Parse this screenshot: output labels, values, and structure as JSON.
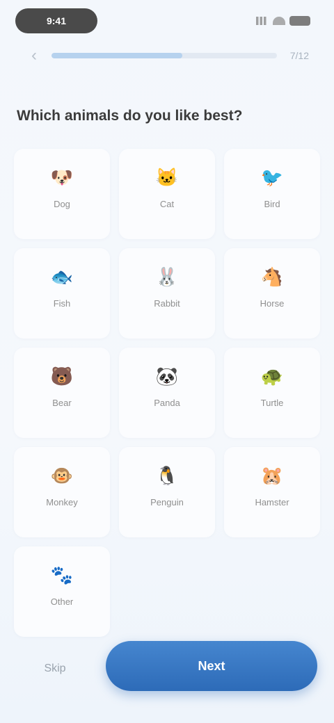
{
  "status_bar": {
    "time": "9:41"
  },
  "header": {
    "progress": 0.58,
    "step_count": "7/12"
  },
  "question": "Which animals do you like best?",
  "options": [
    {
      "label": "Dog",
      "icon": "dog-icon",
      "glyph": "🐶"
    },
    {
      "label": "Cat",
      "icon": "cat-icon",
      "glyph": "🐱"
    },
    {
      "label": "Bird",
      "icon": "bird-icon",
      "glyph": "🐦"
    },
    {
      "label": "Fish",
      "icon": "fish-icon",
      "glyph": "🐟"
    },
    {
      "label": "Rabbit",
      "icon": "rabbit-icon",
      "glyph": "🐰"
    },
    {
      "label": "Horse",
      "icon": "horse-icon",
      "glyph": "🐴"
    },
    {
      "label": "Bear",
      "icon": "bear-icon",
      "glyph": "🐻"
    },
    {
      "label": "Panda",
      "icon": "panda-icon",
      "glyph": "🐼"
    },
    {
      "label": "Turtle",
      "icon": "turtle-icon",
      "glyph": "🐢"
    },
    {
      "label": "Monkey",
      "icon": "monkey-icon",
      "glyph": "🐵"
    },
    {
      "label": "Penguin",
      "icon": "penguin-icon",
      "glyph": "🐧"
    },
    {
      "label": "Hamster",
      "icon": "hamster-icon",
      "glyph": "🐹"
    },
    {
      "label": "Other",
      "icon": "paw-icon",
      "glyph": "🐾"
    }
  ],
  "footer": {
    "skip_label": "Skip",
    "next_label": "Next"
  },
  "colors": {
    "accent": "#2d6bb8",
    "background": "#f4f8fc"
  }
}
